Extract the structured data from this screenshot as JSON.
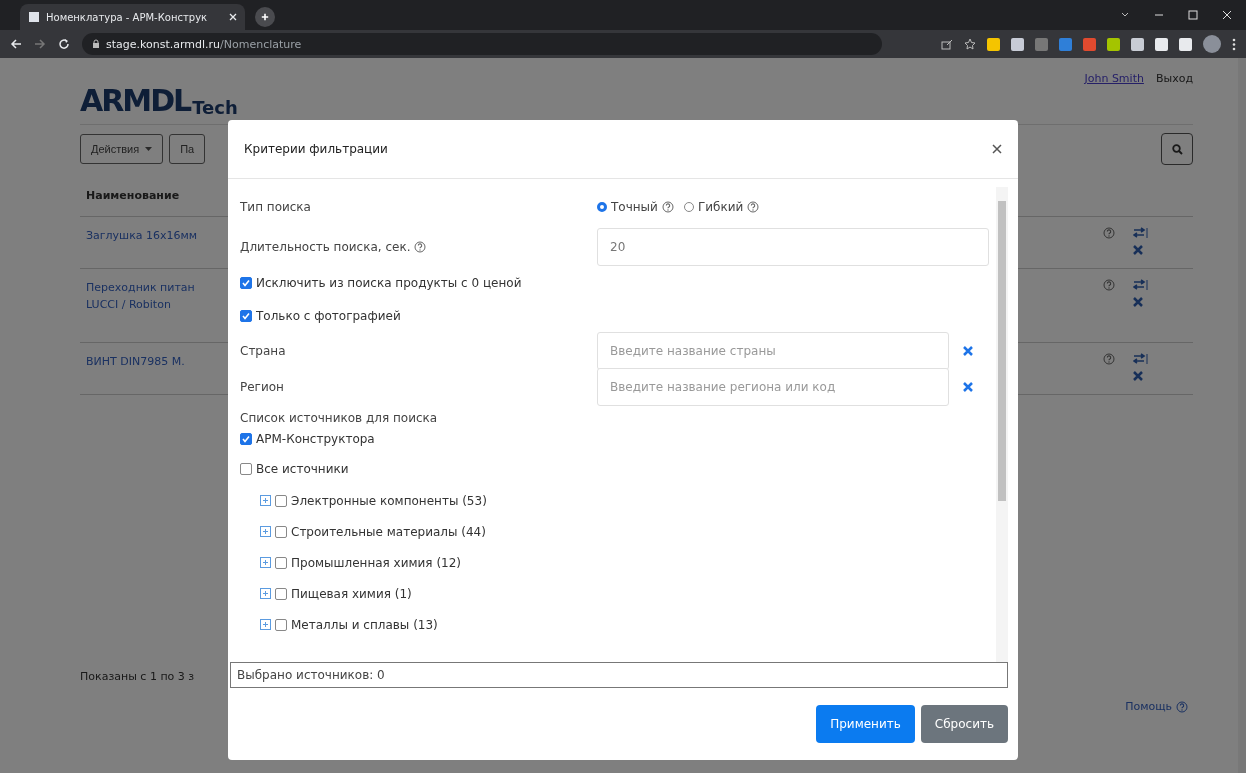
{
  "browser": {
    "tab": {
      "title": "Номенклатура - АРМ-Конструк"
    },
    "address": {
      "domain": "stage.konst.armdl.ru",
      "path": "/Nomenclature"
    }
  },
  "page": {
    "logo": {
      "mark": "ARMDL",
      "word": "Tech"
    },
    "user": {
      "name": "John Smith",
      "logout": "Выход"
    },
    "toolbar": {
      "actions": "Действия",
      "next_button": "Па"
    },
    "table": {
      "columns": [
        "Наименование"
      ],
      "rows": [
        {
          "name": [
            "Заглушка 16х16мм"
          ]
        },
        {
          "name": [
            "Переходник питан",
            "LUCCI / Robiton"
          ]
        },
        {
          "name": [
            "ВИНТ DIN7985 M."
          ]
        }
      ]
    },
    "footer": {
      "shown": "Показаны с 1 по 3 з",
      "help": "Помощь"
    }
  },
  "modal": {
    "title": "Критерии фильтрации",
    "search_type": {
      "label": "Тип поиска",
      "options": [
        {
          "label": "Точный",
          "selected": true
        },
        {
          "label": "Гибкий",
          "selected": false
        }
      ]
    },
    "duration": {
      "label": "Длительность поиска, сек.",
      "value": "20"
    },
    "checkboxes": [
      {
        "label": "Исключить из поиска продукты с 0 ценой",
        "checked": true
      },
      {
        "label": "Только с фотографией",
        "checked": true
      }
    ],
    "country": {
      "label": "Страна",
      "placeholder": "Введите название страны"
    },
    "region": {
      "label": "Регион",
      "placeholder": "Введите название региона или код"
    },
    "sources_label": "Список источников для поиска",
    "own_source": {
      "label": "АРМ-Конструктора",
      "checked": true
    },
    "all_sources": {
      "label": "Все источники",
      "checked": false
    },
    "categories": [
      {
        "label": "Электронные компоненты (53)",
        "checked": false,
        "expanded": false
      },
      {
        "label": "Строительные материалы (44)",
        "checked": false,
        "expanded": false
      },
      {
        "label": "Промышленная химия (12)",
        "checked": false,
        "expanded": false
      },
      {
        "label": "Пищевая химия (1)",
        "checked": false,
        "expanded": false
      },
      {
        "label": "Металлы и сплавы (13)",
        "checked": false,
        "expanded": false
      }
    ],
    "selected_count": "Выбрано источников: 0",
    "buttons": [
      {
        "label": "Применить",
        "kind": "primary"
      },
      {
        "label": "Сбросить",
        "kind": "secondary"
      }
    ]
  }
}
